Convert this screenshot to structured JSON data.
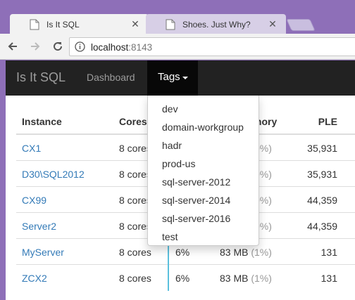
{
  "browser": {
    "tabs": [
      {
        "title": "Is It SQL",
        "active": true
      },
      {
        "title": "Shoes. Just Why?",
        "active": false
      }
    ],
    "url_host": "localhost",
    "url_port": ":8143"
  },
  "navbar": {
    "brand": "Is It SQL",
    "links": [
      "Dashboard"
    ],
    "active_dropdown": "Tags"
  },
  "dropdown": {
    "items": [
      "dev",
      "domain-workgroup",
      "hadr",
      "prod-us",
      "sql-server-2012",
      "sql-server-2014",
      "sql-server-2016",
      "test"
    ]
  },
  "table": {
    "headers": {
      "instance": "Instance",
      "cores": "Cores",
      "memory": "mory",
      "ple": "PLE"
    },
    "rows": [
      {
        "instance": "CX1",
        "cores": "8 cores",
        "cpu": "",
        "memory": "",
        "pct": "0%)",
        "ple": "35,931"
      },
      {
        "instance": "D30\\SQL2012",
        "cores": "8 cores",
        "cpu": "",
        "memory": "",
        "pct": "0%)",
        "ple": "35,931"
      },
      {
        "instance": "CX99",
        "cores": "8 cores",
        "cpu": "",
        "memory": "",
        "pct": "0%)",
        "ple": "44,359"
      },
      {
        "instance": "Server2",
        "cores": "8 cores",
        "cpu": "",
        "memory": "",
        "pct": "0%)",
        "ple": "44,359"
      },
      {
        "instance": "MyServer",
        "cores": "8 cores",
        "cpu": "6%",
        "memory": "83 MB",
        "pct": "(1%)",
        "ple": "131"
      },
      {
        "instance": "ZCX2",
        "cores": "8 cores",
        "cpu": "6%",
        "memory": "83 MB",
        "pct": "(1%)",
        "ple": "131"
      }
    ]
  },
  "colors": {
    "frame": "#8e6fb8",
    "navbar": "#222222",
    "link": "#337ab7",
    "cpu_bar": "#5bc0de"
  },
  "icons": [
    "page-icon",
    "close-icon",
    "back-icon",
    "forward-icon",
    "reload-icon",
    "info-icon",
    "caret-down-icon"
  ]
}
